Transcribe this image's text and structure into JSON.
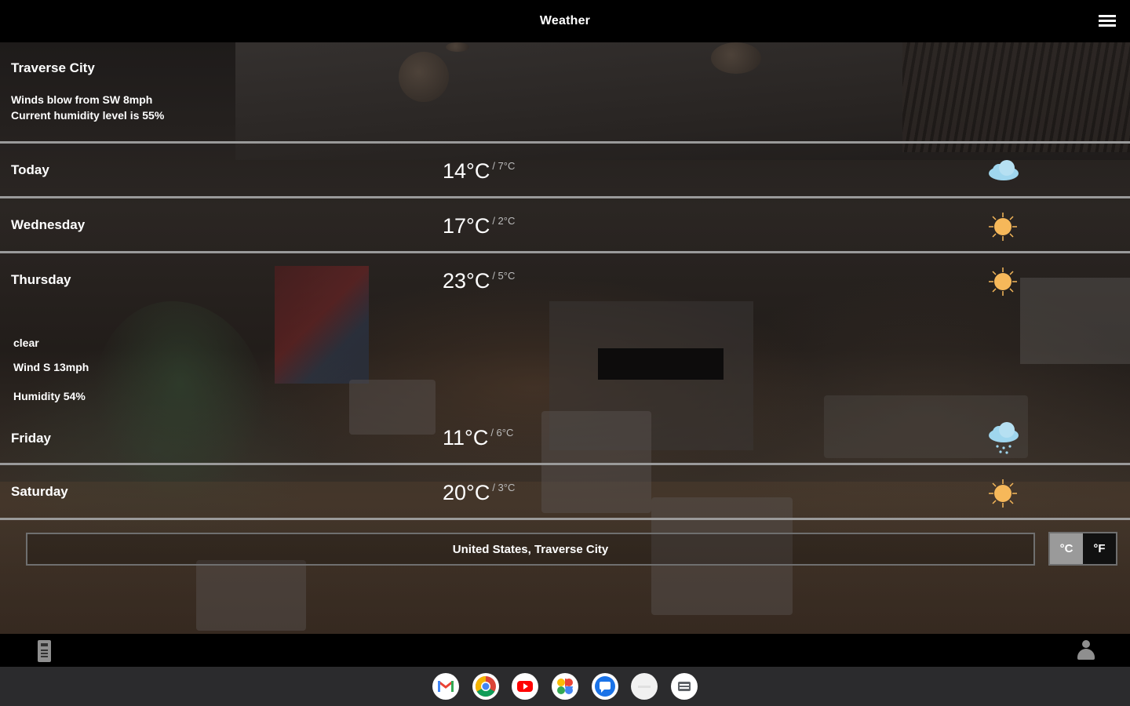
{
  "app": {
    "title": "Weather",
    "menu_icon": "hamburger-menu-icon"
  },
  "location": {
    "name": "Traverse City",
    "wind_line": "Winds blow from SW 8mph",
    "humidity_line": "Current humidity level is 55%"
  },
  "forecast": [
    {
      "day": "Today",
      "high": "14°C",
      "low": "/ 7°C",
      "icon": "cloud-icon"
    },
    {
      "day": "Wednesday",
      "high": "17°C",
      "low": "/ 2°C",
      "icon": "sun-icon"
    },
    {
      "day": "Thursday",
      "high": "23°C",
      "low": "/ 5°C",
      "icon": "sun-icon",
      "details": {
        "condition": "clear",
        "wind": "Wind S 13mph",
        "humidity": "Humidity 54%"
      }
    },
    {
      "day": "Friday",
      "high": "11°C",
      "low": "/ 6°C",
      "icon": "rain-cloud-icon"
    },
    {
      "day": "Saturday",
      "high": "20°C",
      "low": "/ 3°C",
      "icon": "sun-icon"
    }
  ],
  "search": {
    "value": "United States, Traverse City"
  },
  "units": {
    "celsius": "°C",
    "fahrenheit": "°F",
    "selected": "celsius"
  },
  "bottom_bar": {
    "left_icon": "remote-icon",
    "right_icon": "person-icon"
  },
  "shelf": {
    "apps": [
      "gmail-icon",
      "chrome-icon",
      "youtube-icon",
      "photos-icon",
      "messages-icon",
      "blank-app-icon",
      "app-icon"
    ]
  },
  "colors": {
    "sun": "#f6b85a",
    "cloud": "#9fd6ee",
    "row_divider": "#9a9a9a",
    "unit_active": "#9a9a9a"
  }
}
